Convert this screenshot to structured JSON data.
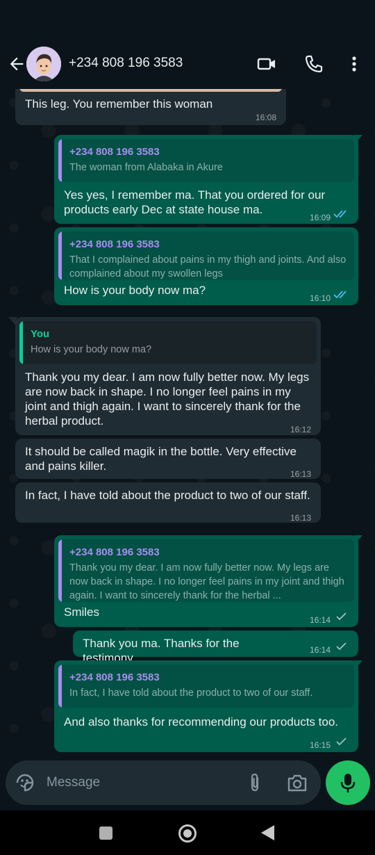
{
  "header": {
    "contact": "+234 808 196 3583"
  },
  "messages": [
    {
      "direction": "in",
      "text": "This leg. You remember this woman",
      "time": "16:08"
    },
    {
      "direction": "out",
      "quote_name": "+234 808 196 3583",
      "quote_text": "The woman from Alabaka in Akure",
      "text": "Yes yes, I remember ma. That you ordered for our products early Dec at state house ma.",
      "time": "16:09",
      "status": "read"
    },
    {
      "direction": "out",
      "quote_name": "+234 808 196 3583",
      "quote_text": "That I complained about pains in my thigh and joints. And also complained about my swollen legs",
      "text": "How is your body now ma?",
      "time": "16:10",
      "status": "read"
    },
    {
      "direction": "in",
      "quote_name": "You",
      "quote_text": "How is your body now ma?",
      "text": "Thank you my dear. I am now fully better now. My legs are now back in shape. I no longer feel pains in my joint and thigh again. I want to sincerely thank for the herbal product.",
      "time": "16:12"
    },
    {
      "direction": "in",
      "text": "It should be called magik in the bottle. Very effective and pains killer.",
      "time": "16:13"
    },
    {
      "direction": "in",
      "text": "In fact, I have told about the product to two of our staff.",
      "time": "16:13"
    },
    {
      "direction": "out",
      "quote_name": "+234 808 196 3583",
      "quote_text": "Thank you my dear. I am now fully better now. My legs are now back in shape. I no longer feel pains in my joint and thigh again. I want to sincerely thank for the herbal ...",
      "text": "Smiles",
      "time": "16:14",
      "status": "sent"
    },
    {
      "direction": "out",
      "text": "Thank you ma. Thanks for the testimony",
      "time": "16:14",
      "status": "sent"
    },
    {
      "direction": "out",
      "quote_name": "+234 808 196 3583",
      "quote_text": "In fact, I have told about the product to two of our staff.",
      "text": "And also thanks for recommending our products too.",
      "time": "16:15",
      "status": "sent"
    }
  ],
  "composer": {
    "placeholder": "Message"
  },
  "icons": {
    "back": "arrow-left-icon",
    "video": "video-camera-icon",
    "call": "phone-icon",
    "menu": "more-vertical-icon",
    "emoji": "sticker-icon",
    "attach": "paperclip-icon",
    "camera": "camera-icon",
    "mic": "microphone-icon",
    "read": "double-check-icon",
    "sent": "check-icon"
  },
  "colors": {
    "background": "#0b141a",
    "incoming_bubble": "#202c33",
    "outgoing_bubble": "#005c4b",
    "accent_green": "#21c063",
    "read_tick": "#53bdeb",
    "quote_name_out": "#a98cf0",
    "quote_name_in": "#06cf9c"
  }
}
